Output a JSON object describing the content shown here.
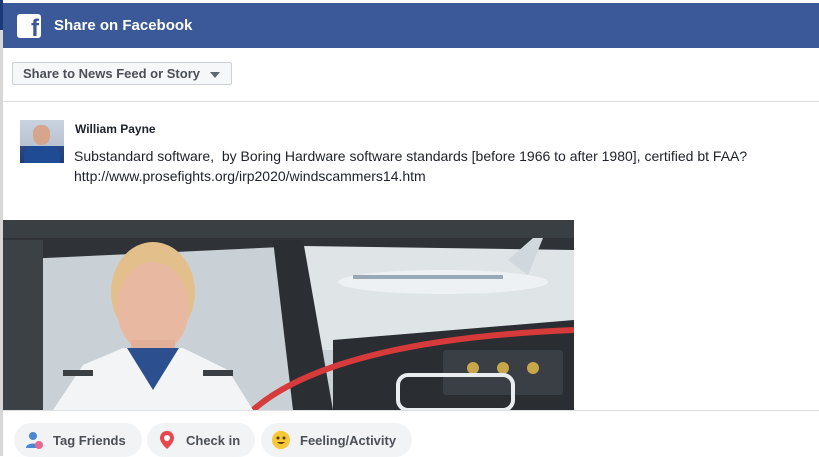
{
  "header": {
    "title": "Share on Facebook",
    "logo_letter": "f"
  },
  "toolbar": {
    "share_target": "Share to News Feed or Story"
  },
  "post": {
    "author": "William Payne",
    "text_line1": "Substandard software,  by Boring Hardware software standards [before 1966 to after 1980], certified bt FAA?",
    "text_line2": "http://www.prosefights.org/irp2020/windscammers14.htm"
  },
  "footer": {
    "tag_friends": "Tag Friends",
    "check_in": "Check in",
    "feeling": "Feeling/Activity"
  },
  "colors": {
    "brand": "#3b5998",
    "pill_bg": "#f2f3f5",
    "text": "#1d2129"
  },
  "icons": [
    "facebook-logo-icon",
    "dropdown-caret-icon",
    "tag-friends-icon",
    "location-pin-icon",
    "smiley-icon"
  ]
}
